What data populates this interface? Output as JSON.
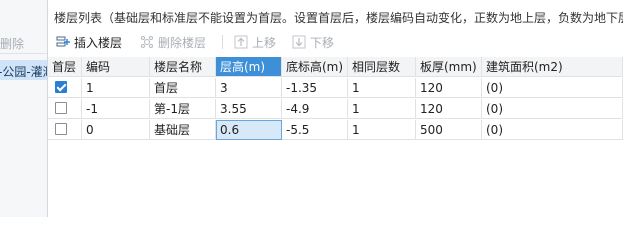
{
  "left": {
    "delete_label": "删除",
    "item_label": "-公园-灌溉"
  },
  "header": {
    "title": "楼层列表（基础层和标准层不能设置为首层。设置首层后，楼层编码自动变化，正数为地上层，负数为地下层"
  },
  "toolbar": {
    "insert_label": "插入楼层",
    "delete_label": "删除楼层",
    "up_label": "上移",
    "down_label": "下移"
  },
  "table": {
    "columns": [
      "首层",
      "编码",
      "楼层名称",
      "层高(m)",
      "底标高(m)",
      "相同层数",
      "板厚(mm)",
      "建筑面积(m2)"
    ],
    "rows": [
      {
        "first": true,
        "code": "1",
        "name": "首层",
        "height": "3",
        "bottom": "-1.35",
        "same": "1",
        "thick": "120",
        "area": "(0)"
      },
      {
        "first": false,
        "code": "-1",
        "name": "第-1层",
        "height": "3.55",
        "bottom": "-4.9",
        "same": "1",
        "thick": "120",
        "area": "(0)"
      },
      {
        "first": false,
        "code": "0",
        "name": "基础层",
        "height": "0.6",
        "bottom": "-5.5",
        "same": "1",
        "thick": "500",
        "area": "(0)"
      }
    ]
  },
  "colors": {
    "active_header": "#3d8fd8",
    "selected_cell": "#d7e8f8",
    "checkbox_on": "#2a7fd4"
  }
}
